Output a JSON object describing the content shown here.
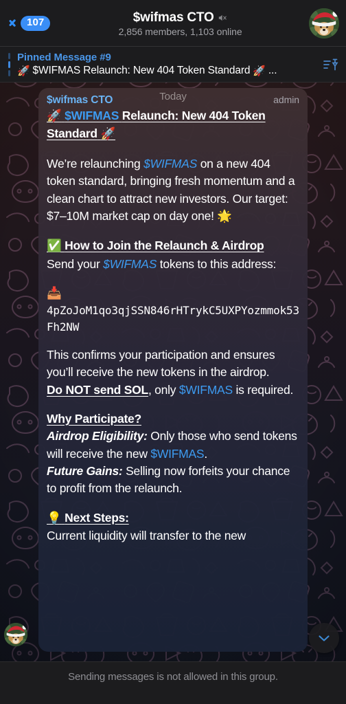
{
  "header": {
    "back_badge": "107",
    "title": "$wifmas CTO",
    "mute_icon": "muted-speaker-icon",
    "subtitle": "2,856 members, 1,103 online",
    "avatar_icon": "dog-santa-avatar"
  },
  "pinned": {
    "label": "Pinned Message #9",
    "snippet_emoji": "🚀",
    "snippet": "$WIFMAS Relaunch: New 404 Token Standard",
    "snippet_emoji_end": "🚀",
    "ellipsis": "...",
    "list_icon": "pinned-list-icon"
  },
  "message": {
    "sender": "$wifmas CTO",
    "date_chip": "Today",
    "admin_label": "admin",
    "title_rocket": "🚀",
    "title_ticker": "$WIFMAS",
    "title_rest": "Relaunch: New 404 Token Standard",
    "title_rocket_end": "🚀",
    "p1_a": "We’re relaunching ",
    "p1_ticker": "$WIFMAS",
    "p1_b": " on a new 404 token standard, bringing fresh momentum and a clean chart to attract new investors. Our target: $7–10M market cap on day one! ",
    "p1_star": "🌟",
    "h2_check": "✅",
    "h2": "How to Join the Relaunch & Airdrop",
    "p2_a": "Send your ",
    "p2_ticker": "$WIFMAS",
    "p2_b": " tokens to this address:",
    "inbox_emoji": "📥",
    "wallet_address": "4pZoJoM1qo3qjSSN846rHTrykC5UXPYozmmok53Fh2NW",
    "p3": "This confirms your participation and ensures you’ll receive the new tokens in the airdrop.",
    "p4_warn": "Do NOT send SOL",
    "p4_a": ", only ",
    "p4_ticker": "$WIFMAS",
    "p4_b": " is required.",
    "h3": "Why Participate?",
    "p5_label": "Airdrop Eligibility:",
    "p5_a": " Only those who send tokens will receive the new ",
    "p5_ticker": "$WIFMAS",
    "p5_b": ".",
    "p6_label": "Future Gains:",
    "p6_a": " Selling now forfeits your chance to profit from the relaunch.",
    "h4_bulb": "💡",
    "h4": "Next Steps:",
    "p7": "Current liquidity will transfer to the new"
  },
  "scroll_button": {
    "icon": "chevron-down-icon"
  },
  "footer": {
    "notice": "Sending messages is not allowed in this group."
  },
  "colors": {
    "accent_blue": "#3d9bf0",
    "badge_blue": "#3a8ef6",
    "pinned_blue": "#4a95e6",
    "header_bg": "#1c1c1e",
    "footer_text": "#8e8e93"
  }
}
